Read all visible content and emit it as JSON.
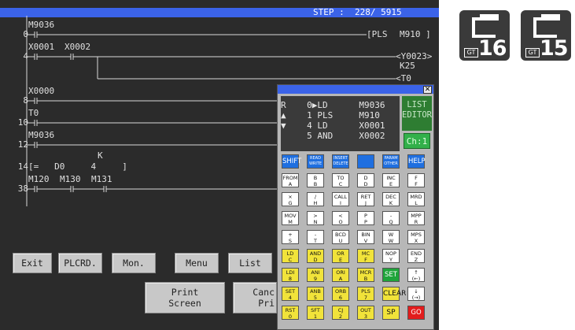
{
  "status": {
    "step_text": "STEP :  228/ 5915"
  },
  "ladder": {
    "rung_numbers": [
      "0",
      "4",
      "8",
      "10",
      "12",
      "14",
      "38"
    ],
    "devices": {
      "m9036_a": "M9036",
      "pls_inst": "[PLS",
      "m910": "M910 ]",
      "x0001": "X0001",
      "x0002": "X0002",
      "y0023": "<Y0023>",
      "k25": "K25",
      "t0_coil": "<T0",
      "x0000": "X0000",
      "t0": "T0",
      "m9036_b": "M9036",
      "k_label": "K",
      "cmp_inst": "[=   D0     4     ]",
      "m120": "M120",
      "m130": "M130",
      "m131": "M131"
    }
  },
  "buttons": {
    "exit": "Exit",
    "plcrd": "PLCRD.",
    "mon": "Mon.",
    "menu": "Menu",
    "list": "List",
    "print_screen_1": "Print",
    "print_screen_2": "Screen",
    "cancel_print_1": "Canc",
    "cancel_print_2": "Pri"
  },
  "list_editor": {
    "close_glyph": "✕",
    "lines": [
      "R    0▶LD      M9036",
      "▲    1 PLS     M910",
      "▼    4 LD      X0001",
      "     5 AND     X0002"
    ],
    "side_label_1": "LIST",
    "side_label_2": "EDITOR",
    "channel": "Ch:1",
    "keys": [
      [
        [
          "SHIFT"
        ],
        [
          "READ",
          "WRITE"
        ],
        [
          "INSERT",
          "DELETE"
        ],
        [
          ""
        ],
        [
          "PARAM",
          "OTHER"
        ],
        [
          "HELP"
        ]
      ],
      [
        [
          "FROM",
          "A"
        ],
        [
          "B",
          "B"
        ],
        [
          "TO",
          "C"
        ],
        [
          "D",
          "D"
        ],
        [
          "INC",
          "E"
        ],
        [
          "F",
          "F"
        ]
      ],
      [
        [
          "×",
          "G"
        ],
        [
          "/",
          "H"
        ],
        [
          "CALL",
          "I"
        ],
        [
          "RET",
          "J"
        ],
        [
          "DEC",
          "K"
        ],
        [
          "MRD",
          "L"
        ]
      ],
      [
        [
          "MOV",
          "M"
        ],
        [
          ">",
          "N"
        ],
        [
          "<",
          "O"
        ],
        [
          "P",
          "P"
        ],
        [
          "-",
          "Q"
        ],
        [
          "MPP",
          "R"
        ]
      ],
      [
        [
          "+",
          "S"
        ],
        [
          "-",
          "T"
        ],
        [
          "BCD",
          "U"
        ],
        [
          "BIN",
          "V"
        ],
        [
          "W",
          "W"
        ],
        [
          "MPS",
          "X"
        ]
      ],
      [
        [
          "LD",
          "C"
        ],
        [
          "AND",
          "D"
        ],
        [
          "OR",
          "E"
        ],
        [
          "MC",
          "F"
        ],
        [
          "NOP",
          "Y"
        ],
        [
          "END",
          "Z"
        ]
      ],
      [
        [
          "LDI",
          "8"
        ],
        [
          "ANI",
          "9"
        ],
        [
          "ORI",
          "A"
        ],
        [
          "MCR",
          "B"
        ],
        [
          "SET"
        ],
        [
          "↑",
          "(←)"
        ]
      ],
      [
        [
          "SET",
          "4"
        ],
        [
          "ANB",
          "5"
        ],
        [
          "ORB",
          "6"
        ],
        [
          "PLS",
          "7"
        ],
        [
          "CLEAR"
        ],
        [
          "↓",
          "(→)"
        ]
      ],
      [
        [
          "RST",
          "0"
        ],
        [
          "SFT",
          "1"
        ],
        [
          "CJ",
          "2"
        ],
        [
          "OUT",
          "3"
        ],
        [
          "SP"
        ],
        [
          "GO"
        ]
      ]
    ]
  },
  "logos": {
    "gt_mark": "GT",
    "model_a": "16",
    "model_b": "15"
  },
  "colors": {
    "screen_bg": "#2b2b2b",
    "title_bar": "#3b63e8",
    "key_blue": "#1f6fe0",
    "key_yellow": "#f1e33a",
    "key_green": "#1fa43a",
    "key_red": "#e21c1c",
    "editor_green": "#2e7d32"
  }
}
